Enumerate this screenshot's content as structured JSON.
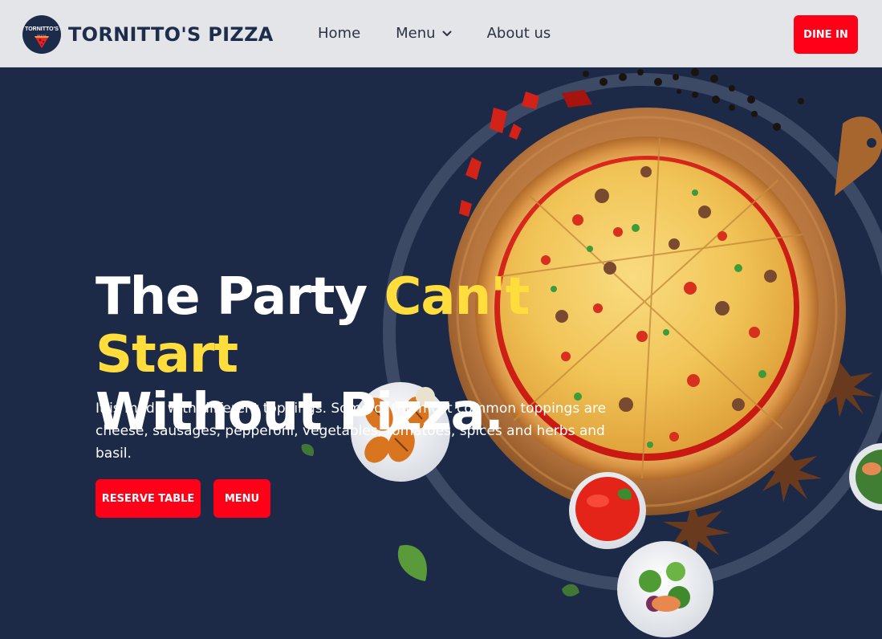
{
  "header": {
    "logo": {
      "text": "TORNITTO'S",
      "subtext": "PIZZA"
    },
    "brand_name": "TORNITTO'S PIZZA",
    "nav": [
      {
        "label": "Home",
        "icon": null
      },
      {
        "label": "Menu",
        "icon": "chevron-down-icon"
      },
      {
        "label": "About us",
        "icon": null
      }
    ],
    "dine_in_label": "DINE IN"
  },
  "hero": {
    "headline_part1": "The Party ",
    "headline_highlight": "Can't Start",
    "headline_part2": "Without Pizza.",
    "description": "It is made with different toppings. Some of the most common toppings are cheese, sausages, pepperoni, vegetables, tomatoes, spices and herbs and basil.",
    "reserve_label": "RESERVE TABLE",
    "menu_label": "MENU"
  },
  "colors": {
    "header_bg": "#e3e5e8",
    "hero_bg": "#1c2a48",
    "brand_text": "#1f2d4d",
    "accent_red": "#ff0018",
    "highlight_yellow": "#ffdd3c"
  }
}
